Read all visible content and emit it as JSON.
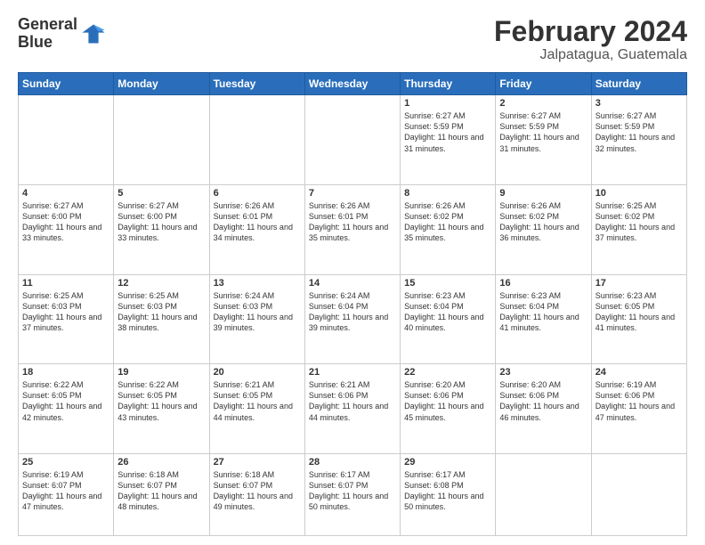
{
  "header": {
    "logo_line1": "General",
    "logo_line2": "Blue",
    "title": "February 2024",
    "subtitle": "Jalpatagua, Guatemala"
  },
  "days_of_week": [
    "Sunday",
    "Monday",
    "Tuesday",
    "Wednesday",
    "Thursday",
    "Friday",
    "Saturday"
  ],
  "weeks": [
    [
      {
        "day": "",
        "info": ""
      },
      {
        "day": "",
        "info": ""
      },
      {
        "day": "",
        "info": ""
      },
      {
        "day": "",
        "info": ""
      },
      {
        "day": "1",
        "info": "Sunrise: 6:27 AM\nSunset: 5:59 PM\nDaylight: 11 hours and 31 minutes."
      },
      {
        "day": "2",
        "info": "Sunrise: 6:27 AM\nSunset: 5:59 PM\nDaylight: 11 hours and 31 minutes."
      },
      {
        "day": "3",
        "info": "Sunrise: 6:27 AM\nSunset: 5:59 PM\nDaylight: 11 hours and 32 minutes."
      }
    ],
    [
      {
        "day": "4",
        "info": "Sunrise: 6:27 AM\nSunset: 6:00 PM\nDaylight: 11 hours and 33 minutes."
      },
      {
        "day": "5",
        "info": "Sunrise: 6:27 AM\nSunset: 6:00 PM\nDaylight: 11 hours and 33 minutes."
      },
      {
        "day": "6",
        "info": "Sunrise: 6:26 AM\nSunset: 6:01 PM\nDaylight: 11 hours and 34 minutes."
      },
      {
        "day": "7",
        "info": "Sunrise: 6:26 AM\nSunset: 6:01 PM\nDaylight: 11 hours and 35 minutes."
      },
      {
        "day": "8",
        "info": "Sunrise: 6:26 AM\nSunset: 6:02 PM\nDaylight: 11 hours and 35 minutes."
      },
      {
        "day": "9",
        "info": "Sunrise: 6:26 AM\nSunset: 6:02 PM\nDaylight: 11 hours and 36 minutes."
      },
      {
        "day": "10",
        "info": "Sunrise: 6:25 AM\nSunset: 6:02 PM\nDaylight: 11 hours and 37 minutes."
      }
    ],
    [
      {
        "day": "11",
        "info": "Sunrise: 6:25 AM\nSunset: 6:03 PM\nDaylight: 11 hours and 37 minutes."
      },
      {
        "day": "12",
        "info": "Sunrise: 6:25 AM\nSunset: 6:03 PM\nDaylight: 11 hours and 38 minutes."
      },
      {
        "day": "13",
        "info": "Sunrise: 6:24 AM\nSunset: 6:03 PM\nDaylight: 11 hours and 39 minutes."
      },
      {
        "day": "14",
        "info": "Sunrise: 6:24 AM\nSunset: 6:04 PM\nDaylight: 11 hours and 39 minutes."
      },
      {
        "day": "15",
        "info": "Sunrise: 6:23 AM\nSunset: 6:04 PM\nDaylight: 11 hours and 40 minutes."
      },
      {
        "day": "16",
        "info": "Sunrise: 6:23 AM\nSunset: 6:04 PM\nDaylight: 11 hours and 41 minutes."
      },
      {
        "day": "17",
        "info": "Sunrise: 6:23 AM\nSunset: 6:05 PM\nDaylight: 11 hours and 41 minutes."
      }
    ],
    [
      {
        "day": "18",
        "info": "Sunrise: 6:22 AM\nSunset: 6:05 PM\nDaylight: 11 hours and 42 minutes."
      },
      {
        "day": "19",
        "info": "Sunrise: 6:22 AM\nSunset: 6:05 PM\nDaylight: 11 hours and 43 minutes."
      },
      {
        "day": "20",
        "info": "Sunrise: 6:21 AM\nSunset: 6:05 PM\nDaylight: 11 hours and 44 minutes."
      },
      {
        "day": "21",
        "info": "Sunrise: 6:21 AM\nSunset: 6:06 PM\nDaylight: 11 hours and 44 minutes."
      },
      {
        "day": "22",
        "info": "Sunrise: 6:20 AM\nSunset: 6:06 PM\nDaylight: 11 hours and 45 minutes."
      },
      {
        "day": "23",
        "info": "Sunrise: 6:20 AM\nSunset: 6:06 PM\nDaylight: 11 hours and 46 minutes."
      },
      {
        "day": "24",
        "info": "Sunrise: 6:19 AM\nSunset: 6:06 PM\nDaylight: 11 hours and 47 minutes."
      }
    ],
    [
      {
        "day": "25",
        "info": "Sunrise: 6:19 AM\nSunset: 6:07 PM\nDaylight: 11 hours and 47 minutes."
      },
      {
        "day": "26",
        "info": "Sunrise: 6:18 AM\nSunset: 6:07 PM\nDaylight: 11 hours and 48 minutes."
      },
      {
        "day": "27",
        "info": "Sunrise: 6:18 AM\nSunset: 6:07 PM\nDaylight: 11 hours and 49 minutes."
      },
      {
        "day": "28",
        "info": "Sunrise: 6:17 AM\nSunset: 6:07 PM\nDaylight: 11 hours and 50 minutes."
      },
      {
        "day": "29",
        "info": "Sunrise: 6:17 AM\nSunset: 6:08 PM\nDaylight: 11 hours and 50 minutes."
      },
      {
        "day": "",
        "info": ""
      },
      {
        "day": "",
        "info": ""
      }
    ]
  ]
}
